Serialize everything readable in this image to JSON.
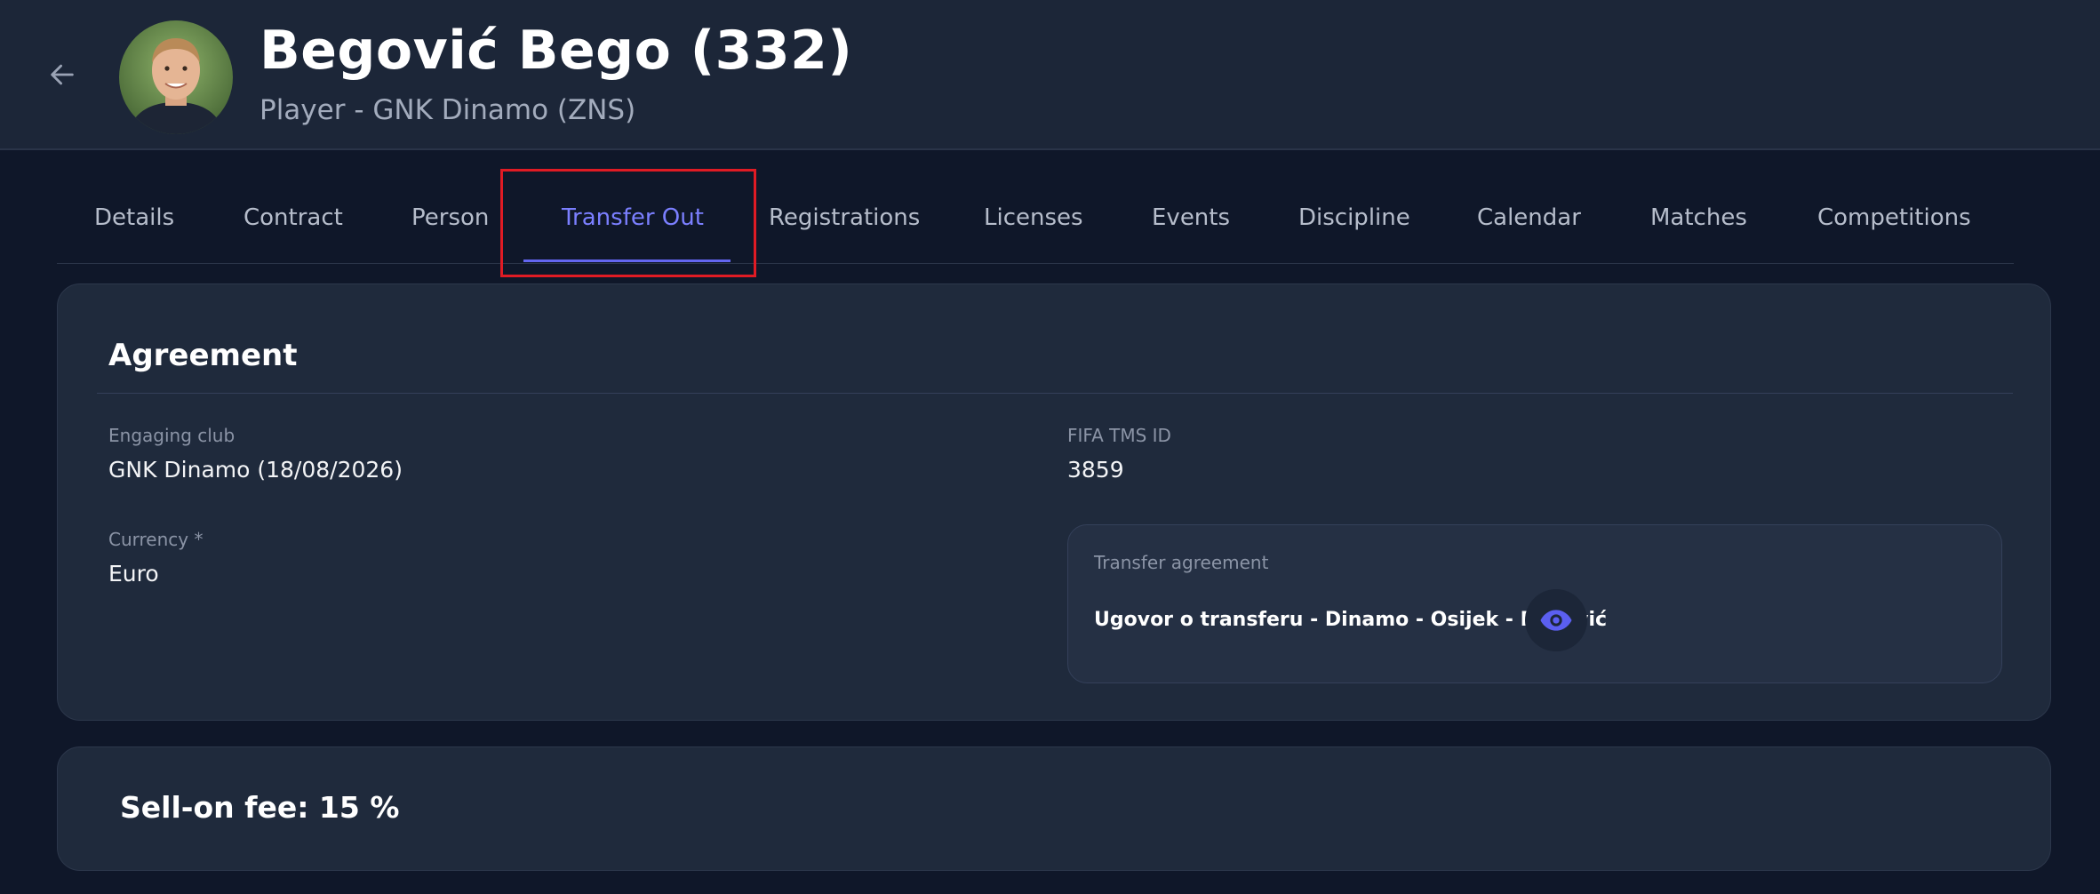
{
  "header": {
    "back_icon": "arrow-left-icon",
    "player_name": "Begović  Bego (332)",
    "subtitle": "Player - GNK Dinamo (ZNS)"
  },
  "tabs": [
    {
      "label": "Details",
      "active": false
    },
    {
      "label": "Contract",
      "active": false
    },
    {
      "label": "Person",
      "active": false
    },
    {
      "label": "Transfer Out",
      "active": true
    },
    {
      "label": "Registrations",
      "active": false
    },
    {
      "label": "Licenses",
      "active": false
    },
    {
      "label": "Events",
      "active": false
    },
    {
      "label": "Discipline",
      "active": false
    },
    {
      "label": "Calendar",
      "active": false
    },
    {
      "label": "Matches",
      "active": false
    },
    {
      "label": "Competitions",
      "active": false
    }
  ],
  "agreement": {
    "title": "Agreement",
    "engaging_club_label": "Engaging club",
    "engaging_club_value": "GNK Dinamo (18/08/2026)",
    "fifa_label": "FIFA TMS ID",
    "fifa_value": "3859",
    "currency_label": "Currency *",
    "currency_value": "Euro",
    "transfer_agreement_label": "Transfer agreement",
    "transfer_agreement_file": "Ugovor o transferu - Dinamo - Osijek - Begović",
    "view_icon": "eye-icon"
  },
  "sell_on": {
    "text": "Sell-on fee: 15 %"
  },
  "colors": {
    "accent": "#6366f1",
    "highlight": "#e01b24",
    "background": "#0f1729",
    "card": "#1f2a3c"
  }
}
